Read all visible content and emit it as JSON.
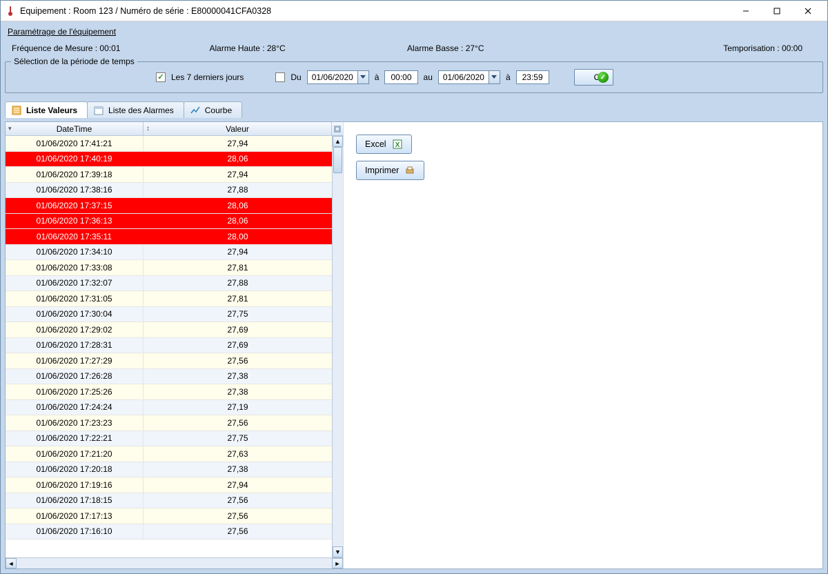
{
  "titlebar": {
    "title": "Equipement : Room 123 / Numéro de série : E80000041CFA0328"
  },
  "params": {
    "header_link": "Paramétrage de l'équipement",
    "freq_label": "Fréquence de Mesure : 00:01",
    "alarm_high": "Alarme Haute : 28°C",
    "alarm_low": "Alarme Basse : 27°C",
    "tempo": "Temporisation : 00:00"
  },
  "period": {
    "legend": "Sélection de la période de temps",
    "last7_label": "Les 7 derniers jours",
    "last7_checked": true,
    "from_label": "Du",
    "from_date": "01/06/2020",
    "a1": "à",
    "from_time": "00:00",
    "to_label": "au",
    "to_date": "01/06/2020",
    "a2": "à",
    "to_time": "23:59",
    "ok_label": "OK"
  },
  "tabs": {
    "values": "Liste Valeurs",
    "alarms": "Liste des Alarmes",
    "chart": "Courbe"
  },
  "table": {
    "col_datetime": "DateTime",
    "col_value": "Valeur",
    "rows": [
      {
        "dt": "01/06/2020 17:41:21",
        "v": "27,94",
        "alarm": false
      },
      {
        "dt": "01/06/2020 17:40:19",
        "v": "28,06",
        "alarm": true
      },
      {
        "dt": "01/06/2020 17:39:18",
        "v": "27,94",
        "alarm": false
      },
      {
        "dt": "01/06/2020 17:38:16",
        "v": "27,88",
        "alarm": false
      },
      {
        "dt": "01/06/2020 17:37:15",
        "v": "28,06",
        "alarm": true
      },
      {
        "dt": "01/06/2020 17:36:13",
        "v": "28,06",
        "alarm": true
      },
      {
        "dt": "01/06/2020 17:35:11",
        "v": "28,00",
        "alarm": true
      },
      {
        "dt": "01/06/2020 17:34:10",
        "v": "27,94",
        "alarm": false
      },
      {
        "dt": "01/06/2020 17:33:08",
        "v": "27,81",
        "alarm": false
      },
      {
        "dt": "01/06/2020 17:32:07",
        "v": "27,88",
        "alarm": false
      },
      {
        "dt": "01/06/2020 17:31:05",
        "v": "27,81",
        "alarm": false
      },
      {
        "dt": "01/06/2020 17:30:04",
        "v": "27,75",
        "alarm": false
      },
      {
        "dt": "01/06/2020 17:29:02",
        "v": "27,69",
        "alarm": false
      },
      {
        "dt": "01/06/2020 17:28:31",
        "v": "27,69",
        "alarm": false
      },
      {
        "dt": "01/06/2020 17:27:29",
        "v": "27,56",
        "alarm": false
      },
      {
        "dt": "01/06/2020 17:26:28",
        "v": "27,38",
        "alarm": false
      },
      {
        "dt": "01/06/2020 17:25:26",
        "v": "27,38",
        "alarm": false
      },
      {
        "dt": "01/06/2020 17:24:24",
        "v": "27,19",
        "alarm": false
      },
      {
        "dt": "01/06/2020 17:23:23",
        "v": "27,56",
        "alarm": false
      },
      {
        "dt": "01/06/2020 17:22:21",
        "v": "27,75",
        "alarm": false
      },
      {
        "dt": "01/06/2020 17:21:20",
        "v": "27,63",
        "alarm": false
      },
      {
        "dt": "01/06/2020 17:20:18",
        "v": "27,38",
        "alarm": false
      },
      {
        "dt": "01/06/2020 17:19:16",
        "v": "27,94",
        "alarm": false
      },
      {
        "dt": "01/06/2020 17:18:15",
        "v": "27,56",
        "alarm": false
      },
      {
        "dt": "01/06/2020 17:17:13",
        "v": "27,56",
        "alarm": false
      },
      {
        "dt": "01/06/2020 17:16:10",
        "v": "27,56",
        "alarm": false
      }
    ]
  },
  "buttons": {
    "excel": "Excel",
    "print": "Imprimer"
  }
}
